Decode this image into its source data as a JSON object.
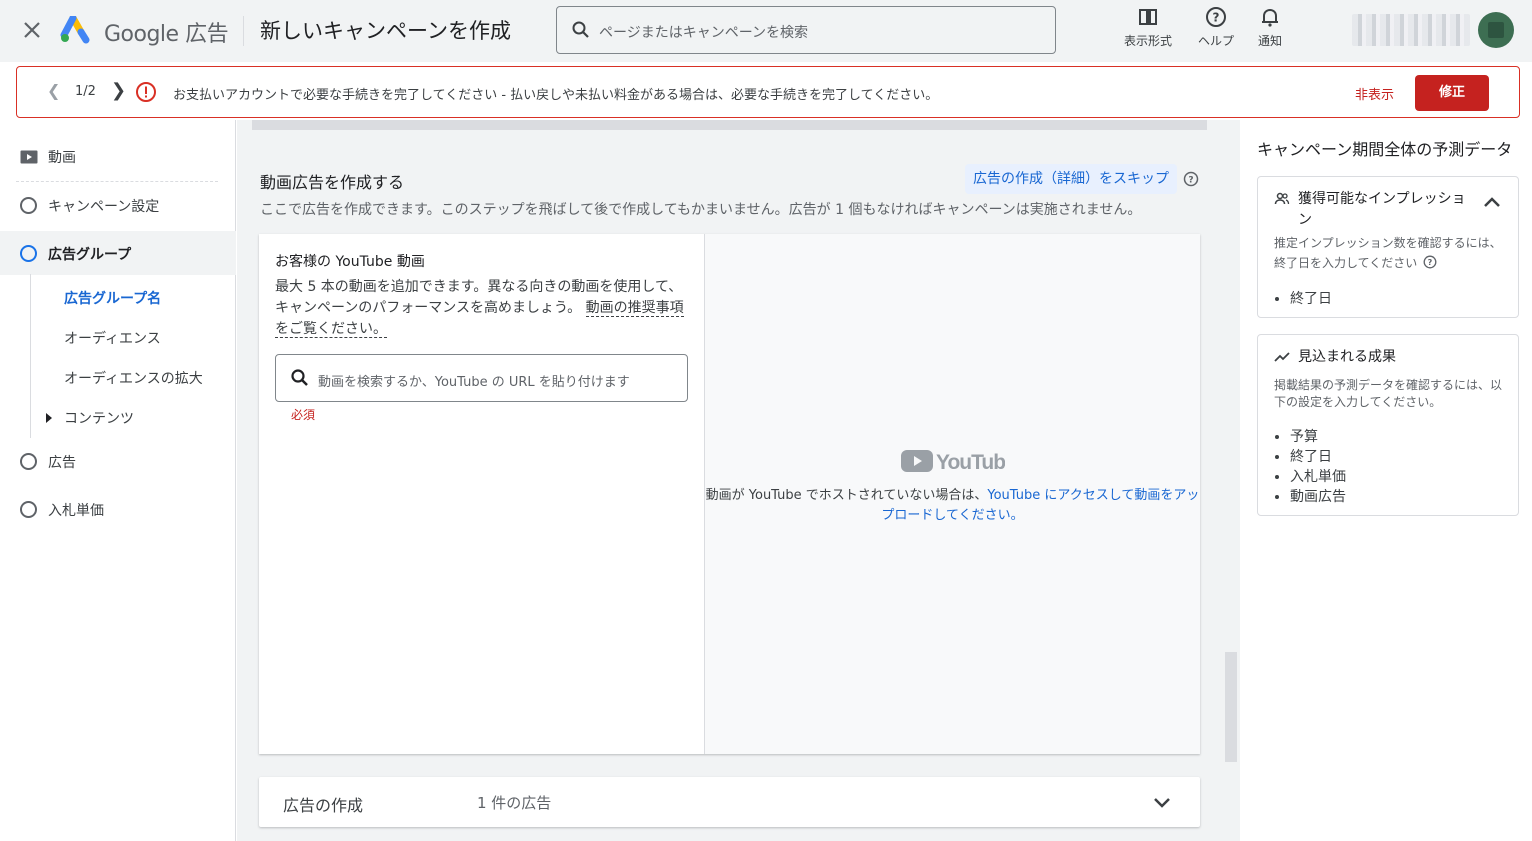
{
  "header": {
    "brand_google": "Google",
    "brand_ads": "広告",
    "page_title": "新しいキャンペーンを作成",
    "search_placeholder": "ページまたはキャンペーンを検索",
    "tools": [
      {
        "label": "表示形式",
        "icon": "appearance-icon"
      },
      {
        "label": "ヘルプ",
        "icon": "help-icon"
      },
      {
        "label": "通知",
        "icon": "bell-icon"
      }
    ]
  },
  "alert": {
    "pager": "1/2",
    "message": "お支払いアカウントで必要な手続きを完了してください - 払い戻しや未払い料金がある場合は、必要な手続きを完了してください。",
    "hide_label": "非表示",
    "fix_label": "修正"
  },
  "sidebar": {
    "section_video": "動画",
    "items": [
      {
        "label": "キャンペーン設定"
      },
      {
        "label": "広告グループ"
      },
      {
        "label": "広告"
      },
      {
        "label": "入札単価"
      }
    ],
    "subitems": [
      {
        "label": "広告グループ名"
      },
      {
        "label": "オーディエンス"
      },
      {
        "label": "オーディエンスの拡大"
      },
      {
        "label": "コンテンツ"
      }
    ]
  },
  "main": {
    "section_title": "動画広告を作成する",
    "skip_link": "広告の作成（詳細）をスキップ",
    "section_desc": "ここで広告を作成できます。このステップを飛ばして後で作成してもかまいません。広告が 1 個もなければキャンペーンは実施されません。",
    "card": {
      "title": "お客様の YouTube 動画",
      "body": "最大 5 本の動画を追加できます。異なる向きの動画を使用して、キャンペーンのパフォーマンスを高めましょう。",
      "body_link": "動画の推奨事項をご覧ください。",
      "search_placeholder": "動画を検索するか、YouTube の URL を貼り付けます",
      "required": "必須",
      "yt_text_prefix": "動画が YouTube でホストされていない場合は、",
      "yt_link": "YouTube にアクセスして動画をアップロードしてください。"
    },
    "collapse": {
      "title": "広告の作成",
      "count": "1 件の広告"
    }
  },
  "right_panel": {
    "title": "キャンペーン期間全体の予測データ",
    "impressions": {
      "title": "獲得可能なインプレッション",
      "desc": "推定インプレッション数を確認するには、終了日を入力してください",
      "items": [
        "終了日"
      ]
    },
    "results": {
      "title": "見込まれる成果",
      "desc": "掲載結果の予測データを確認するには、以下の設定を入力してください。",
      "items": [
        "予算",
        "終了日",
        "入札単価",
        "動画広告"
      ]
    }
  },
  "colors": {
    "accent_blue": "#1a73e8",
    "error_red": "#c5221f"
  }
}
